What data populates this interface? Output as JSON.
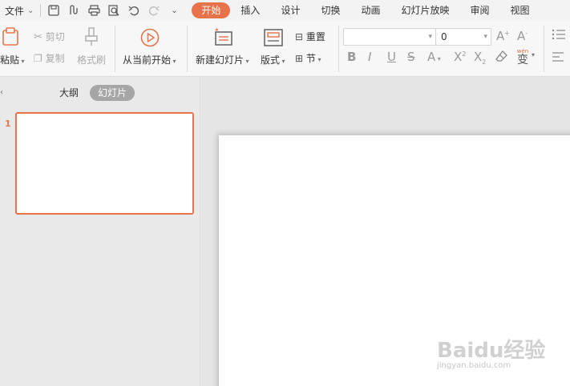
{
  "menubar": {
    "file_label": "文件",
    "tabs": [
      "开始",
      "插入",
      "设计",
      "切换",
      "动画",
      "幻灯片放映",
      "审阅",
      "视图"
    ],
    "active_tab": "开始"
  },
  "ribbon": {
    "paste": "粘贴",
    "cut": "剪切",
    "copy": "复制",
    "format_painter": "格式刷",
    "from_current": "从当前开始",
    "new_slide": "新建幻灯片",
    "layout": "版式",
    "reset": "重置",
    "section": "节",
    "font_name": "",
    "font_size": "0",
    "phonetic": "wén"
  },
  "left_pane": {
    "outline_tab": "大纲",
    "slides_tab": "幻灯片",
    "slide_number": "1"
  },
  "watermark": {
    "logo": "Baidu经验",
    "url": "jingyan.baidu.com"
  },
  "colors": {
    "accent": "#e8734a"
  }
}
